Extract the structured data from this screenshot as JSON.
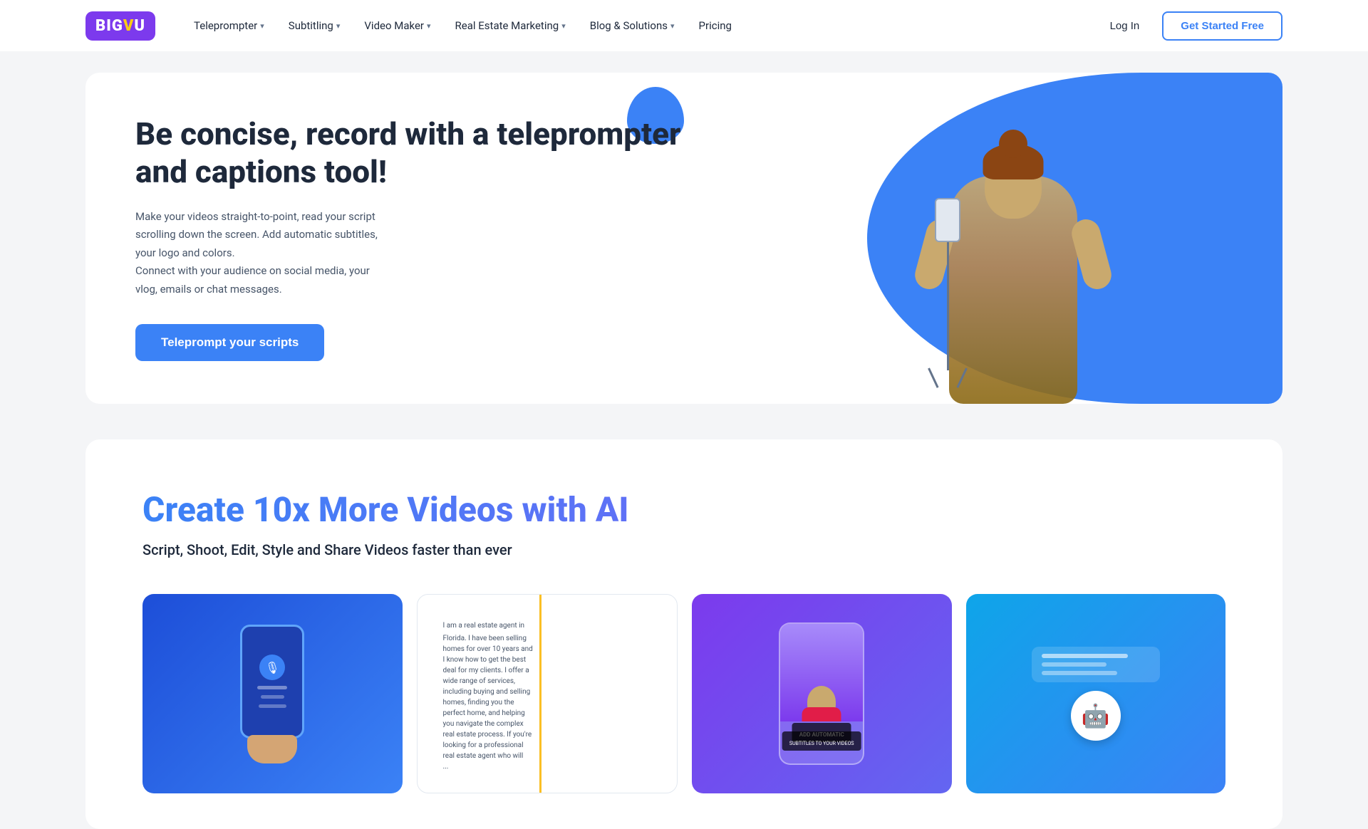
{
  "brand": {
    "name": "BIGVU",
    "highlight_char": "U"
  },
  "nav": {
    "items": [
      {
        "label": "Teleprompter",
        "has_dropdown": true
      },
      {
        "label": "Subtitling",
        "has_dropdown": true
      },
      {
        "label": "Video Maker",
        "has_dropdown": true
      },
      {
        "label": "Real Estate Marketing",
        "has_dropdown": true
      },
      {
        "label": "Blog & Solutions",
        "has_dropdown": true
      },
      {
        "label": "Pricing",
        "has_dropdown": false
      }
    ],
    "login_label": "Log In",
    "cta_label": "Get Started Free"
  },
  "hero": {
    "title": "Be concise, record with a teleprompter and captions tool!",
    "description_line1": "Make your videos straight-to-point, read your script",
    "description_line2": "scrolling down the screen. Add automatic subtitles,",
    "description_line3": "your logo and colors.",
    "description_line4": "Connect with your audience on social media, your",
    "description_line5": "vlog, emails or chat messages.",
    "cta_label": "Teleprompt your scripts"
  },
  "second_section": {
    "title": "Create 10x More Videos with AI",
    "subtitle": "Script, Shoot, Edit, Style and Share Videos faster than ever"
  },
  "feature_cards": [
    {
      "id": "card-record",
      "type": "phone-hand"
    },
    {
      "id": "card-script",
      "type": "text"
    },
    {
      "id": "card-subtitles",
      "type": "person"
    },
    {
      "id": "card-ai",
      "type": "robot"
    }
  ],
  "colors": {
    "brand_blue": "#3b82f6",
    "brand_purple": "#7c3aed",
    "dark_text": "#1e293b",
    "muted_text": "#475569"
  }
}
